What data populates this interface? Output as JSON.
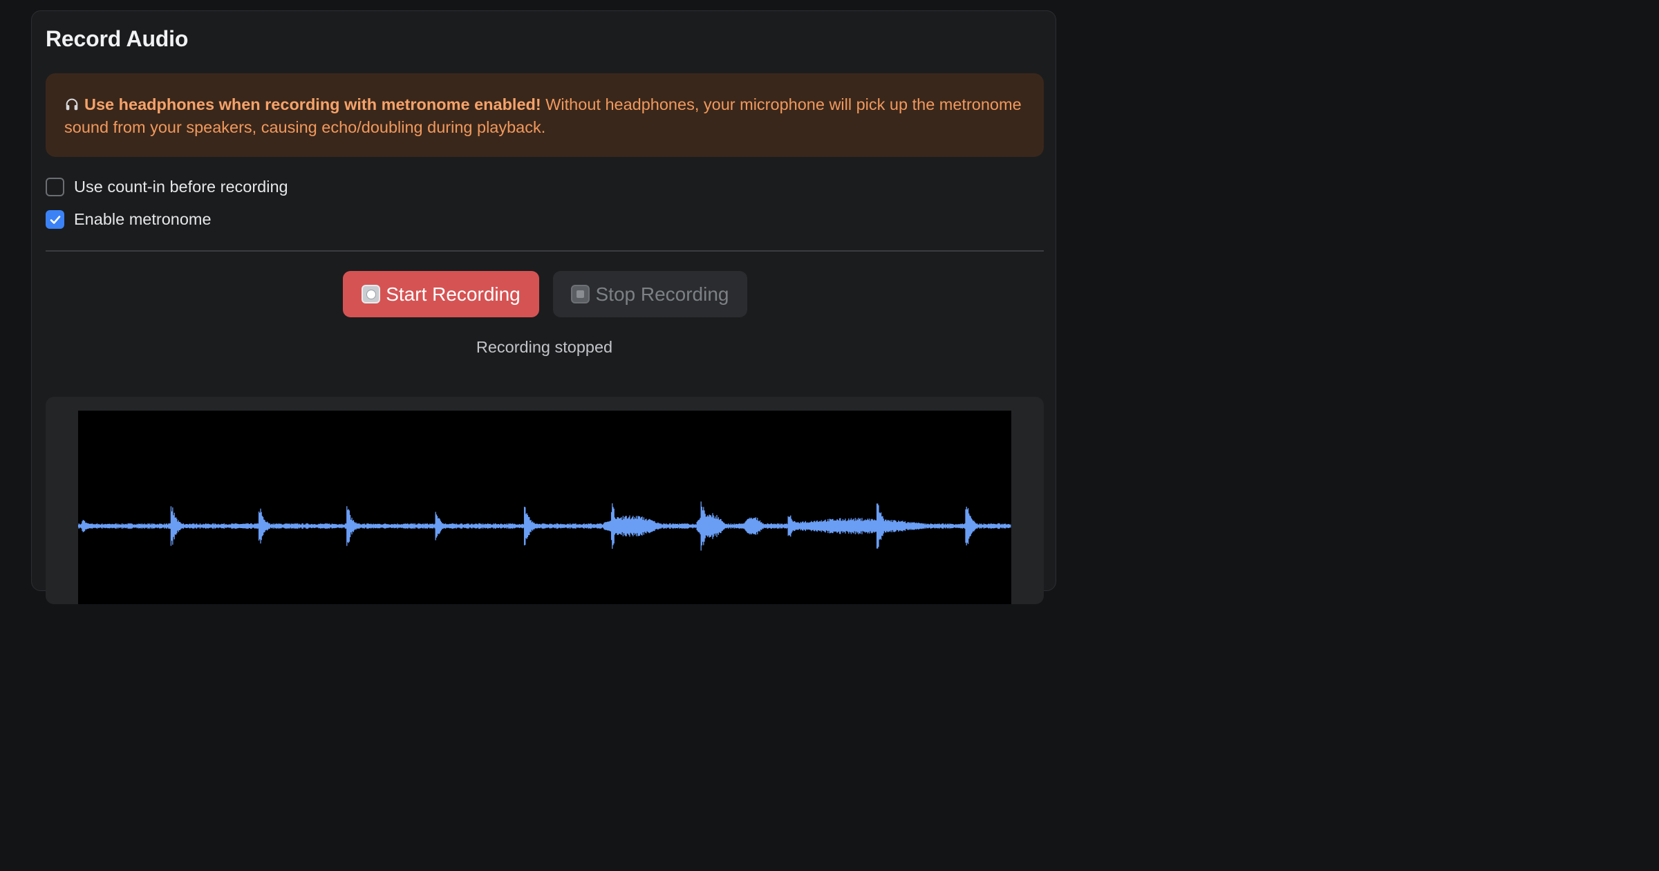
{
  "title": "Record Audio",
  "warning": {
    "icon": "headphones-icon",
    "bold": "Use headphones when recording with metronome enabled!",
    "text": " Without headphones, your microphone will pick up the metronome sound from your speakers, causing echo/doubling during playback."
  },
  "options": {
    "count_in": {
      "label": "Use count-in before recording",
      "checked": false
    },
    "metronome": {
      "label": "Enable metronome",
      "checked": true
    }
  },
  "buttons": {
    "start": {
      "label": "Start Recording",
      "icon": "record-icon",
      "color": "#d65353"
    },
    "stop": {
      "label": "Stop Recording",
      "icon": "stop-icon",
      "enabled": false
    }
  },
  "status": "Recording stopped",
  "waveform": {
    "color": "#6a9ef5",
    "background": "#000000"
  }
}
